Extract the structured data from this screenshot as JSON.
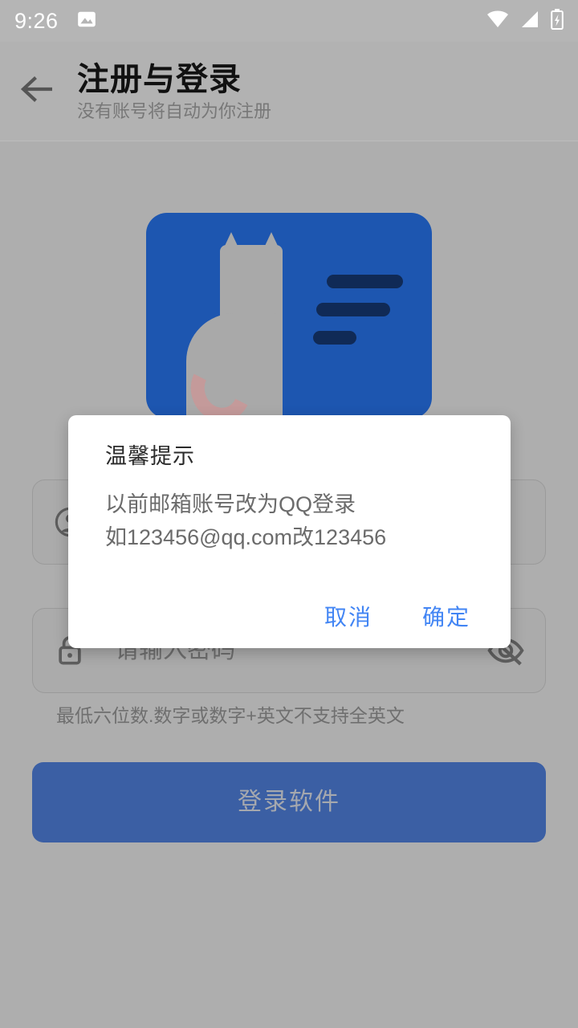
{
  "status_bar": {
    "time": "9:26",
    "notification_icon": "image-notification-icon",
    "wifi_icon": "wifi-icon",
    "signal_icon": "cellular-signal-icon",
    "battery_icon": "battery-charging-icon"
  },
  "header": {
    "back_icon": "back-arrow-icon",
    "title": "注册与登录",
    "subtitle": "没有账号将自动为你注册"
  },
  "hero": {
    "illustration_name": "cat-id-card-illustration",
    "card_color": "#1d56b0",
    "cat_color": "#a9a9a9",
    "tail_color": "#c49a9a",
    "line_color": "#102a56"
  },
  "form": {
    "account": {
      "icon": "account-circle-icon",
      "placeholder": "",
      "value": ""
    },
    "password": {
      "icon": "lock-icon",
      "placeholder": "请输入密码",
      "value": "",
      "toggle_icon": "eye-off-icon"
    },
    "password_hint": "最低六位数.数字或数字+英文不支持全英文",
    "login_button_label": "登录软件",
    "login_button_color": "#3b5fa4"
  },
  "dialog": {
    "title": "温馨提示",
    "message": "以前邮箱账号改为QQ登录\n如123456@qq.com改123456",
    "cancel_label": "取消",
    "confirm_label": "确定",
    "action_color": "#4285f4"
  }
}
